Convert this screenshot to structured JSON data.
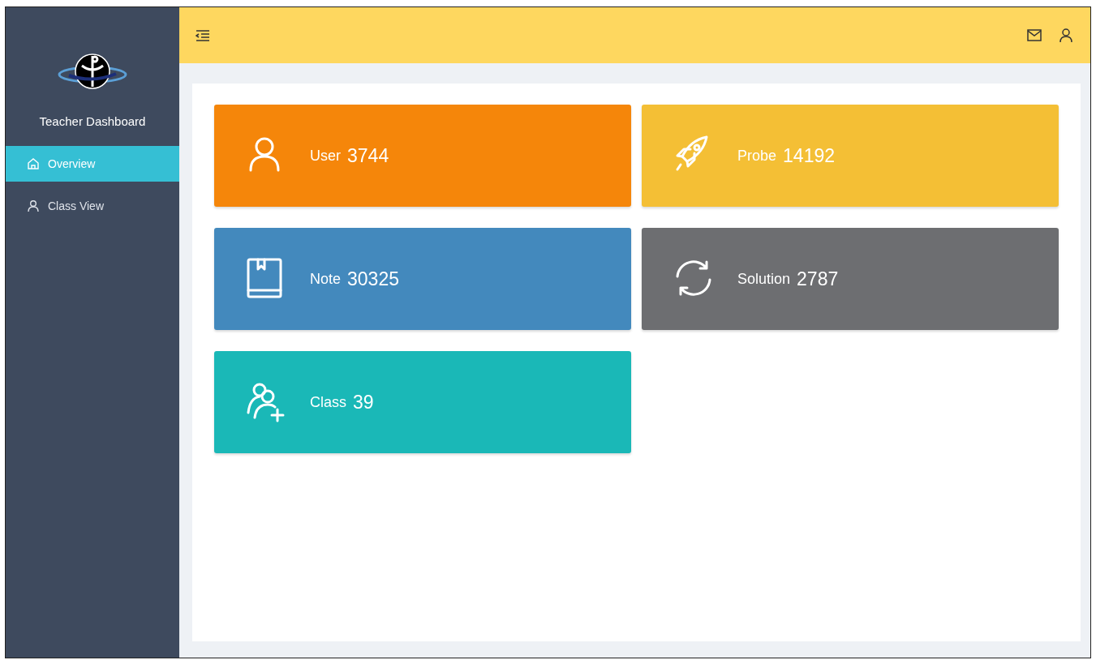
{
  "sidebar": {
    "title": "Teacher Dashboard",
    "items": [
      {
        "label": "Overview",
        "kind": "home",
        "selected": true
      },
      {
        "label": "Class View",
        "kind": "user",
        "selected": false
      }
    ]
  },
  "cards": [
    {
      "label": "User",
      "count": "3744",
      "kind": "user",
      "color": "#f5860a"
    },
    {
      "label": "Probe",
      "count": "14192",
      "kind": "rocket",
      "color": "#f4bf35"
    },
    {
      "label": "Note",
      "count": "30325",
      "kind": "book",
      "color": "#4389bd"
    },
    {
      "label": "Solution",
      "count": "2787",
      "kind": "sync",
      "color": "#6d6e71"
    },
    {
      "label": "Class",
      "count": "39",
      "kind": "team",
      "color": "#1ab8b7"
    }
  ]
}
